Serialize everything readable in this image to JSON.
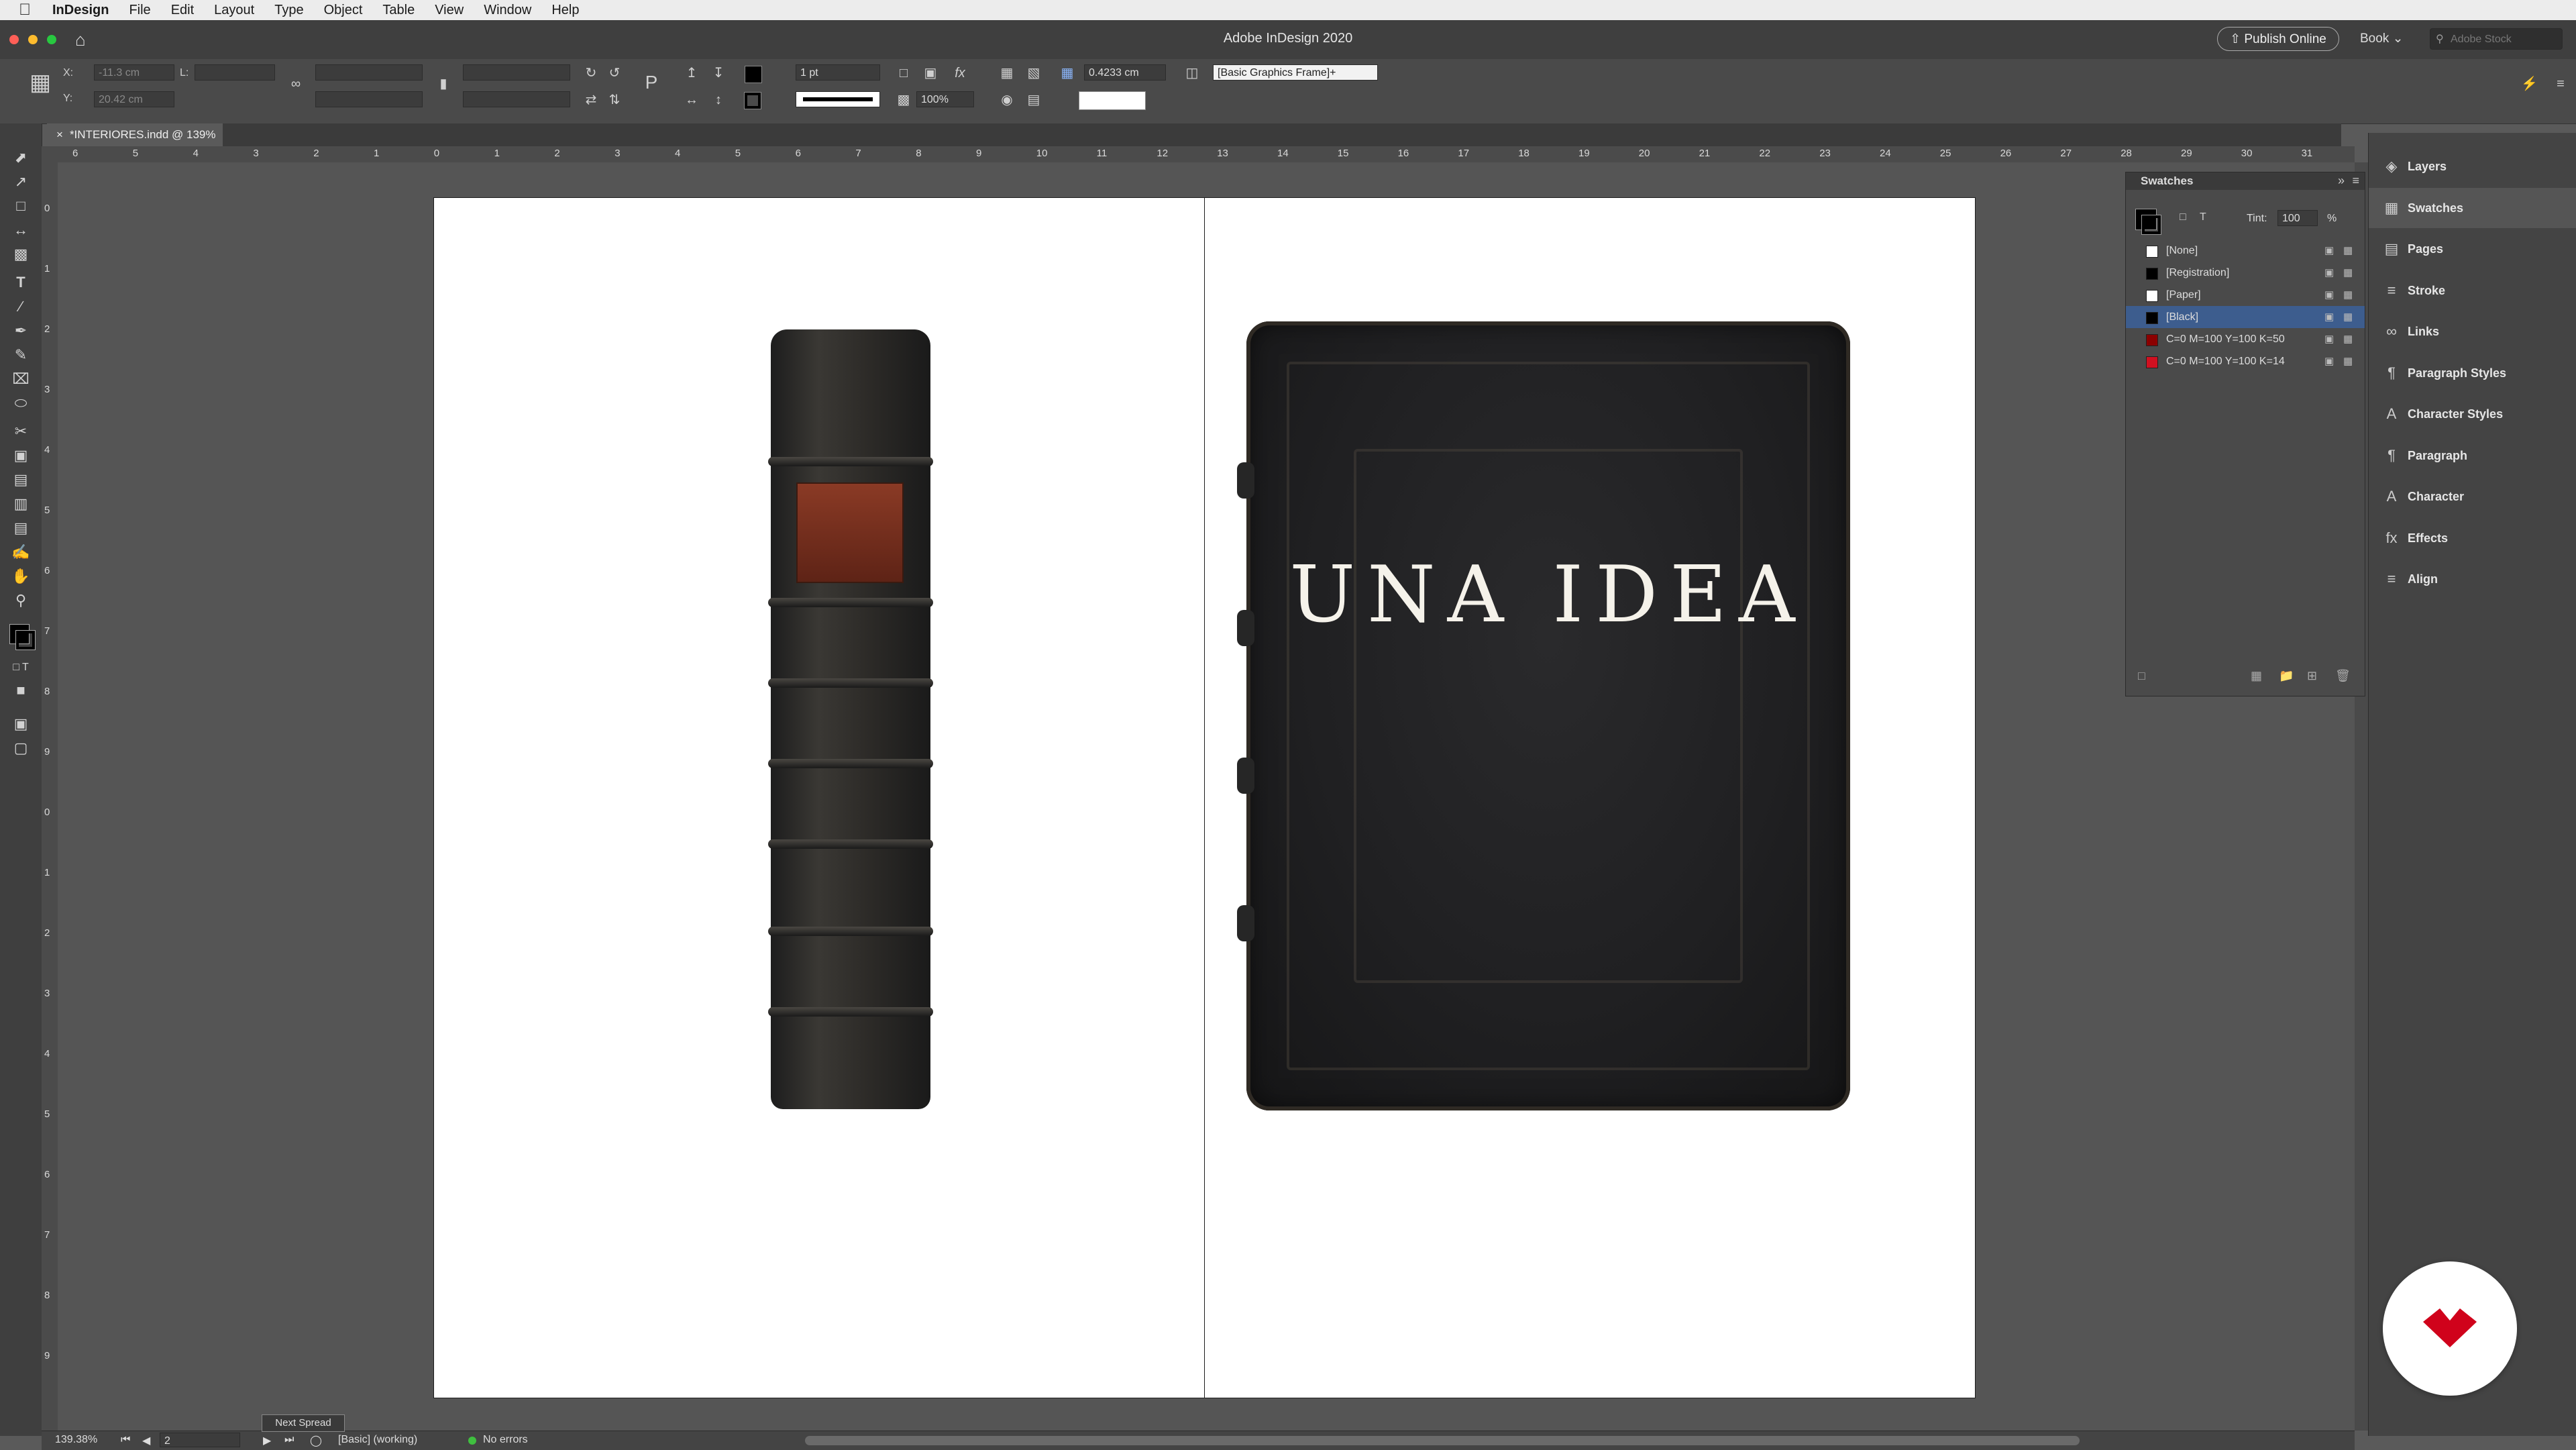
{
  "menubar": {
    "app": "InDesign",
    "items": [
      "File",
      "Edit",
      "Layout",
      "Type",
      "Object",
      "Table",
      "View",
      "Window",
      "Help"
    ]
  },
  "titlebar": {
    "title": "Adobe InDesign 2020",
    "publish": "Publish Online",
    "book": "Book",
    "search_placeholder": "Adobe Stock"
  },
  "control": {
    "x": "-11.3 cm",
    "y": "20.42 cm",
    "stroke_weight": "1 pt",
    "scale": "100%",
    "offset": "0.4233 cm",
    "object_style": "[Basic Graphics Frame]+"
  },
  "document": {
    "tab": "*INTERIORES.indd @ 139%"
  },
  "ruler": {
    "h_ticks": [
      "6",
      "5",
      "4",
      "3",
      "2",
      "1",
      "0",
      "1",
      "2",
      "3",
      "4",
      "5",
      "6",
      "7",
      "8",
      "9",
      "10",
      "11",
      "12",
      "13",
      "14",
      "15",
      "16",
      "17",
      "18",
      "19",
      "20",
      "21",
      "22",
      "23",
      "24",
      "25",
      "26",
      "27",
      "28",
      "29",
      "30",
      "31"
    ],
    "v_ticks": [
      "0",
      "1",
      "2",
      "3",
      "4",
      "5",
      "6",
      "7",
      "8",
      "9",
      "0",
      "1",
      "2",
      "3",
      "4",
      "5",
      "6",
      "7",
      "8",
      "9"
    ]
  },
  "cover": {
    "title": "UNA IDEA"
  },
  "swatches": {
    "title": "Swatches",
    "tint_label": "Tint:",
    "tint_value": "100",
    "tint_unit": "%",
    "items": [
      {
        "name": "[None]",
        "color": "#ffffff",
        "selected": false
      },
      {
        "name": "[Registration]",
        "color": "#000000",
        "selected": false
      },
      {
        "name": "[Paper]",
        "color": "#ffffff",
        "selected": false
      },
      {
        "name": "[Black]",
        "color": "#000000",
        "selected": true
      },
      {
        "name": "C=0 M=100 Y=100 K=50",
        "color": "#8b0000",
        "selected": false
      },
      {
        "name": "C=0 M=100 Y=100 K=14",
        "color": "#d01020",
        "selected": false
      }
    ]
  },
  "dock": {
    "items": [
      "Layers",
      "Swatches",
      "Pages",
      "Stroke",
      "Links",
      "Paragraph Styles",
      "Character Styles",
      "Paragraph",
      "Character",
      "Effects",
      "Align"
    ],
    "active": "Swatches"
  },
  "status": {
    "zoom": "139.38%",
    "page": "2",
    "profile": "[Basic] (working)",
    "errors": "No errors",
    "tooltip": "Next Spread"
  },
  "colors": {
    "accent": "#3d5d8e",
    "logo": "#d0021b",
    "ok": "#3fbf3f"
  }
}
